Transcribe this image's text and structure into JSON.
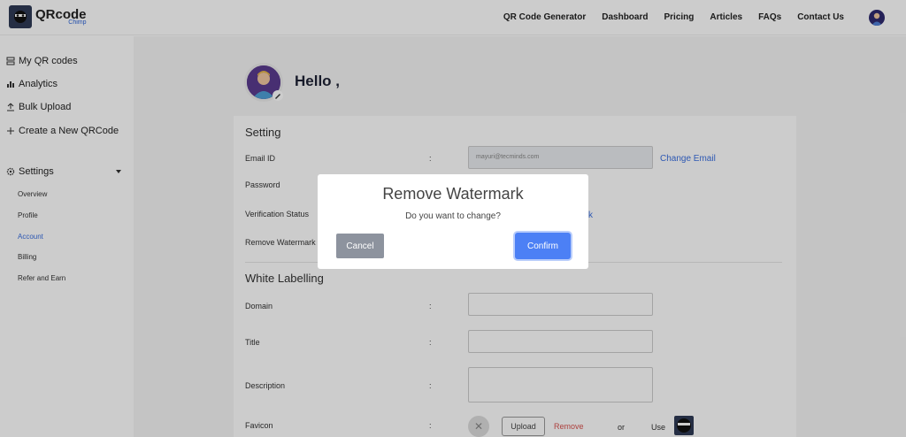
{
  "brand": {
    "name": "QRcode",
    "tagline": "Chimp"
  },
  "nav": {
    "items": [
      "QR Code Generator",
      "Dashboard",
      "Pricing",
      "Articles",
      "FAQs",
      "Contact Us"
    ]
  },
  "sidebar": {
    "items": [
      {
        "label": "My QR codes",
        "icon": "list-icon"
      },
      {
        "label": "Analytics",
        "icon": "bar-chart-icon"
      },
      {
        "label": "Bulk Upload",
        "icon": "upload-icon"
      },
      {
        "label": "Create a New QRCode",
        "icon": "plus-icon"
      }
    ],
    "settings": {
      "label": "Settings",
      "icon": "gear-icon",
      "subitems": [
        "Overview",
        "Profile",
        "Account",
        "Billing",
        "Refer and Earn"
      ],
      "active": "Account"
    }
  },
  "profile": {
    "greeting": "Hello ,"
  },
  "setting": {
    "title": "Setting",
    "rows": [
      {
        "label": "Email ID",
        "value": "mayuri@tecminds.com",
        "action": "Change Email"
      },
      {
        "label": "Password"
      },
      {
        "label": "Verification Status",
        "action_fragment": "k"
      },
      {
        "label": "Remove Watermark"
      }
    ]
  },
  "white_labelling": {
    "title": "White Labelling",
    "fields": [
      "Domain",
      "Title",
      "Description",
      "Favicon"
    ],
    "favicon": {
      "upload": "Upload",
      "remove": "Remove",
      "or": "or",
      "use": "Use"
    }
  },
  "colon": ":",
  "modal": {
    "title": "Remove Watermark",
    "message": "Do you want to change?",
    "cancel": "Cancel",
    "confirm": "Confirm"
  },
  "colors": {
    "accent": "#4c80f5",
    "link": "#3a6fe0",
    "danger": "#d9534f"
  }
}
